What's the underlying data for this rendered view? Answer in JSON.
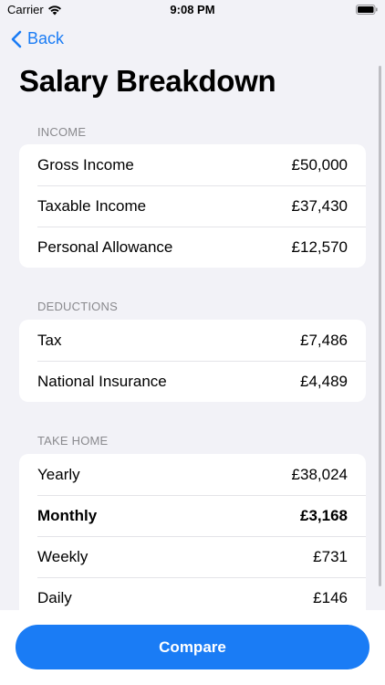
{
  "status_bar": {
    "carrier": "Carrier",
    "time": "9:08 PM",
    "icons": [
      "wifi-icon",
      "battery-icon"
    ]
  },
  "nav": {
    "back_label": "Back",
    "back_icon": "chevron-left-icon"
  },
  "title": "Salary Breakdown",
  "sections": {
    "income": {
      "header": "INCOME",
      "rows": [
        {
          "label": "Gross Income",
          "value": "£50,000"
        },
        {
          "label": "Taxable Income",
          "value": "£37,430"
        },
        {
          "label": "Personal Allowance",
          "value": "£12,570"
        }
      ]
    },
    "deductions": {
      "header": "DEDUCTIONS",
      "rows": [
        {
          "label": "Tax",
          "value": "£7,486"
        },
        {
          "label": "National Insurance",
          "value": "£4,489"
        }
      ]
    },
    "take_home": {
      "header": "TAKE HOME",
      "rows": [
        {
          "label": "Yearly",
          "value": "£38,024"
        },
        {
          "label": "Monthly",
          "value": "£3,168"
        },
        {
          "label": "Weekly",
          "value": "£731"
        },
        {
          "label": "Daily",
          "value": "£146"
        }
      ]
    }
  },
  "footer": {
    "compare_label": "Compare"
  },
  "colors": {
    "accent": "#1A7CF5",
    "background": "#F2F2F7",
    "card": "#FFFFFF",
    "secondary_text": "#8A8A8E"
  }
}
